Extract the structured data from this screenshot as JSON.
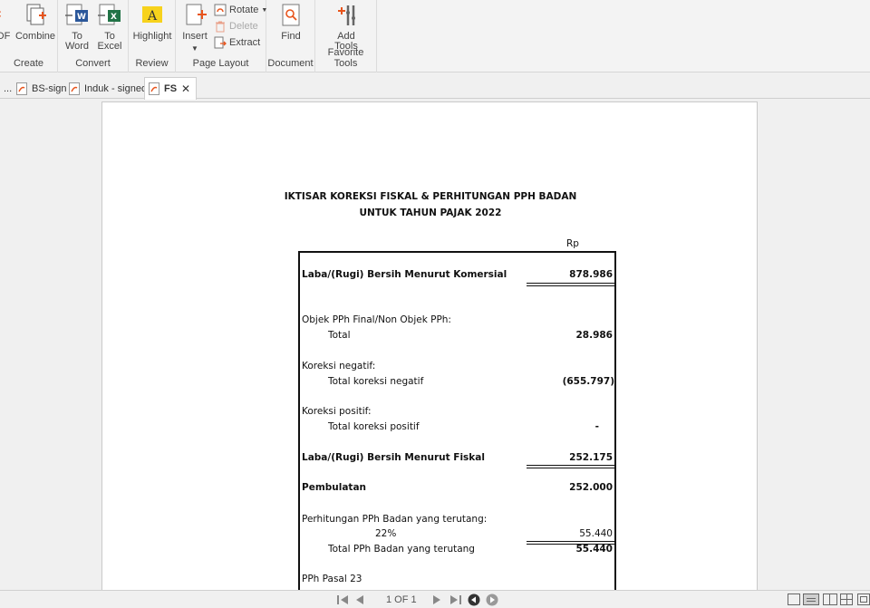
{
  "ribbon": {
    "groups": {
      "create": "Create",
      "convert": "Convert",
      "review": "Review",
      "page_layout": "Page Layout",
      "document": "Document",
      "favorite_tools": "Favorite Tools"
    },
    "buttons": {
      "pdf": "DF",
      "combine": "Combine",
      "to_word_1": "To",
      "to_word_2": "Word",
      "to_excel_1": "To",
      "to_excel_2": "Excel",
      "highlight": "Highlight",
      "insert": "Insert",
      "rotate": "Rotate",
      "delete": "Delete",
      "extract": "Extract",
      "find": "Find",
      "add_tools_1": "Add",
      "add_tools_2": "Tools"
    }
  },
  "tabs": {
    "overflow": "...",
    "items": [
      "BS-sign",
      "Induk - signed",
      "FS"
    ]
  },
  "document": {
    "title1": "IKTISAR KOREKSI FISKAL & PERHITUNGAN PPH BADAN",
    "title2": "UNTUK TAHUN PAJAK 2022",
    "currency": "Rp",
    "rows": {
      "laba_komersial": {
        "label": "Laba/(Rugi) Bersih Menurut Komersial",
        "value": "878.986"
      },
      "objek_final": {
        "label": "Objek PPh Final/Non Objek PPh:"
      },
      "total1": {
        "label": "Total",
        "value": "28.986"
      },
      "koreksi_negatif": {
        "label": "Koreksi negatif:"
      },
      "total_negatif": {
        "label": "Total koreksi negatif",
        "value": "(655.797)"
      },
      "koreksi_positif": {
        "label": "Koreksi positif:"
      },
      "total_positif": {
        "label": "Total koreksi positif",
        "value": "-"
      },
      "laba_fiskal": {
        "label": "Laba/(Rugi) Bersih Menurut Fiskal",
        "value": "252.175"
      },
      "pembulatan": {
        "label": "Pembulatan",
        "value": "252.000"
      },
      "perhitungan": {
        "label": "Perhitungan PPh Badan yang terutang:"
      },
      "tarif": {
        "label": "22%",
        "value": "55.440"
      },
      "total_pph": {
        "label": "Total PPh Badan yang terutang",
        "value": "55.440"
      },
      "pph23": {
        "label": "PPh Pasal 23"
      }
    }
  },
  "status": {
    "page_indicator": "1 OF 1"
  },
  "colors": {
    "word_blue": "#2b579a",
    "excel_green": "#217346",
    "pdf_orange": "#e8541c",
    "highlight_yellow": "#f7d21c"
  }
}
